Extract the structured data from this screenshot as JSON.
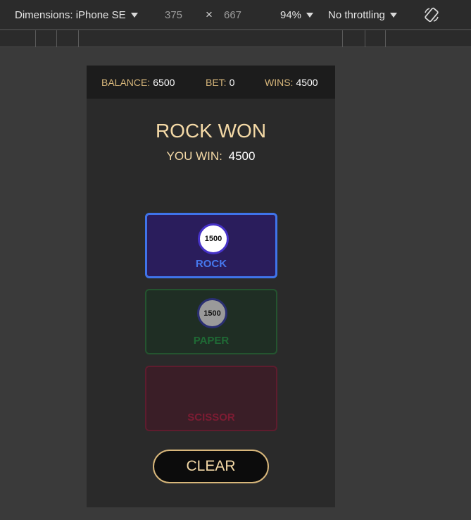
{
  "devtools": {
    "dimensions_label": "Dimensions: iPhone SE",
    "width": "375",
    "times": "×",
    "height": "667",
    "zoom": "94%",
    "throttling": "No throttling",
    "rotate_icon": "rotate-icon"
  },
  "game": {
    "balance_label": "BALANCE:",
    "balance_value": "6500",
    "bet_label": "BET:",
    "bet_value": "0",
    "wins_label": "WINS:",
    "wins_value": "4500",
    "result_title": "ROCK WON",
    "you_win_label": "YOU WIN:",
    "you_win_value": "4500",
    "choices": [
      {
        "label": "ROCK",
        "chip": "1500"
      },
      {
        "label": "PAPER",
        "chip": "1500"
      },
      {
        "label": "SCISSOR"
      }
    ],
    "clear_label": "CLEAR"
  },
  "colors": {
    "accent_gold": "#d8b77b",
    "rock_border": "#3f74ea",
    "paper_border": "#24542f",
    "scissor_border": "#5e1c2e"
  }
}
